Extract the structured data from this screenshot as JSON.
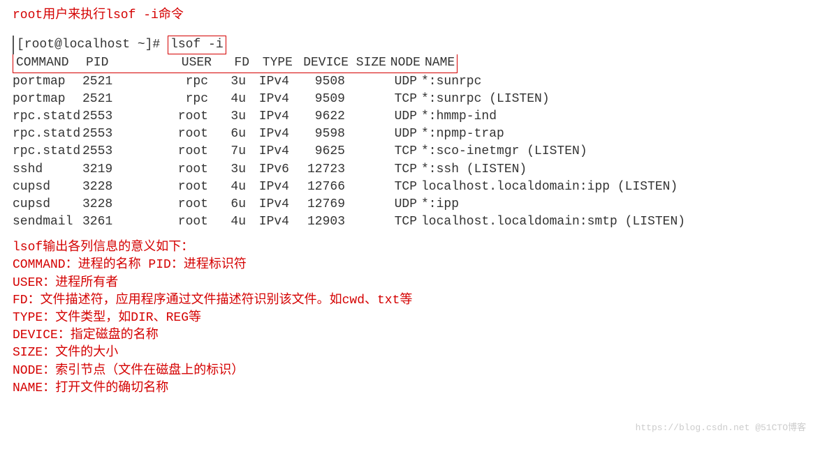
{
  "title": "root用户来执行lsof -i命令",
  "prompt": "[root@localhost ~]#",
  "cmd": "lsof -i",
  "headers": {
    "command": "COMMAND",
    "pid": "PID",
    "user": "USER",
    "fd": "FD",
    "type": "TYPE",
    "device": "DEVICE",
    "size": "SIZE",
    "node": "NODE",
    "name": "NAME"
  },
  "rows": [
    {
      "command": "portmap",
      "pid": "2521",
      "user": "rpc",
      "fd": "3u",
      "type": "IPv4",
      "device": "9508",
      "size": "",
      "node": "UDP",
      "name": "*:sunrpc"
    },
    {
      "command": "portmap",
      "pid": "2521",
      "user": "rpc",
      "fd": "4u",
      "type": "IPv4",
      "device": "9509",
      "size": "",
      "node": "TCP",
      "name": "*:sunrpc (LISTEN)"
    },
    {
      "command": "rpc.statd",
      "pid": "2553",
      "user": "root",
      "fd": "3u",
      "type": "IPv4",
      "device": "9622",
      "size": "",
      "node": "UDP",
      "name": "*:hmmp-ind"
    },
    {
      "command": "rpc.statd",
      "pid": "2553",
      "user": "root",
      "fd": "6u",
      "type": "IPv4",
      "device": "9598",
      "size": "",
      "node": "UDP",
      "name": "*:npmp-trap"
    },
    {
      "command": "rpc.statd",
      "pid": "2553",
      "user": "root",
      "fd": "7u",
      "type": "IPv4",
      "device": "9625",
      "size": "",
      "node": "TCP",
      "name": "*:sco-inetmgr (LISTEN)"
    },
    {
      "command": "sshd",
      "pid": "3219",
      "user": "root",
      "fd": "3u",
      "type": "IPv6",
      "device": "12723",
      "size": "",
      "node": "TCP",
      "name": "*:ssh (LISTEN)"
    },
    {
      "command": "cupsd",
      "pid": "3228",
      "user": "root",
      "fd": "4u",
      "type": "IPv4",
      "device": "12766",
      "size": "",
      "node": "TCP",
      "name": "localhost.localdomain:ipp (LISTEN)"
    },
    {
      "command": "cupsd",
      "pid": "3228",
      "user": "root",
      "fd": "6u",
      "type": "IPv4",
      "device": "12769",
      "size": "",
      "node": "UDP",
      "name": "*:ipp"
    },
    {
      "command": "sendmail",
      "pid": "3261",
      "user": "root",
      "fd": "4u",
      "type": "IPv4",
      "device": "12903",
      "size": "",
      "node": "TCP",
      "name": "localhost.localdomain:smtp (LISTEN)"
    }
  ],
  "explain": {
    "l0": "lsof输出各列信息的意义如下：",
    "l1": "COMMAND：进程的名称 PID：进程标识符",
    "l2": "USER：进程所有者",
    "l3": "FD：文件描述符，应用程序通过文件描述符识别该文件。如cwd、txt等",
    "l4": "TYPE：文件类型，如DIR、REG等",
    "l5": "DEVICE：指定磁盘的名称",
    "l6": "SIZE：文件的大小",
    "l7": "NODE：索引节点（文件在磁盘上的标识）",
    "l8": "NAME：打开文件的确切名称"
  },
  "watermark": "https://blog.csdn.net @51CTO博客"
}
